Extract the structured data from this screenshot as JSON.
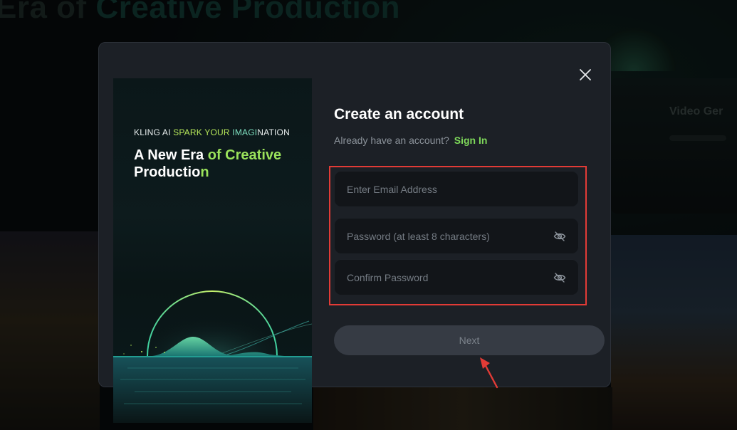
{
  "background": {
    "title_prefix": "Era of ",
    "title_highlight": "Creative Production",
    "side_text": "Video Ger"
  },
  "promo": {
    "tag_part1": "KLING AI ",
    "tag_part2": "SPARK YOUR ",
    "tag_part3": "IMAGI",
    "tag_part4": "NATION",
    "headline_part1": "A New Era ",
    "headline_part2": "of Creative",
    "headline_part3": "Productio",
    "headline_part4": "n"
  },
  "form": {
    "title": "Create an account",
    "signin_prompt": "Already have an account?",
    "signin_link": "Sign In",
    "email_placeholder": "Enter Email Address",
    "password_placeholder": "Password (at least 8 characters)",
    "confirm_placeholder": "Confirm Password",
    "next_label": "Next"
  },
  "icons": {
    "close": "close-icon",
    "password_toggle": "eye-off-icon",
    "annotation": "red-arrow-icon"
  },
  "colors": {
    "accent_green": "#7ed95a",
    "highlight_red": "#e23b36",
    "modal_bg": "#1c2026",
    "field_bg": "#121519",
    "button_bg": "#363b44"
  }
}
